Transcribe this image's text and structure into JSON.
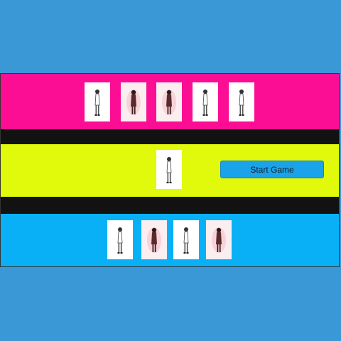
{
  "colors": {
    "background": "#3b98d6",
    "top_band": "#fb0e94",
    "middle_band": "#e1fa0c",
    "bottom_band": "#0ab0f5",
    "separator": "#121212",
    "button": "#1aa3e8"
  },
  "top_hand": [
    {
      "art": "figure-light"
    },
    {
      "art": "figure-dark"
    },
    {
      "art": "figure-dark"
    },
    {
      "art": "figure-light"
    },
    {
      "art": "figure-light"
    }
  ],
  "center_card": {
    "art": "figure-light"
  },
  "bottom_hand": [
    {
      "art": "figure-light"
    },
    {
      "art": "figure-dark"
    },
    {
      "art": "figure-light"
    },
    {
      "art": "figure-dark"
    }
  ],
  "controls": {
    "start_label": "Start Game"
  }
}
